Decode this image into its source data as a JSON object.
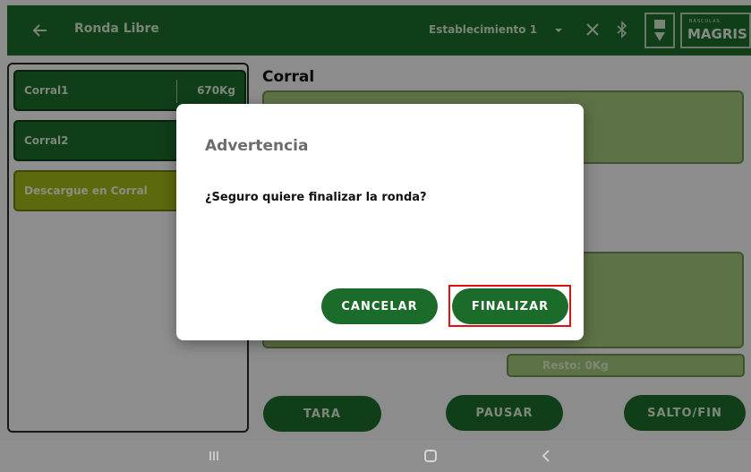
{
  "appbar": {
    "title": "Ronda Libre",
    "establishment": "Establecimiento 1",
    "logo_small": "BÁSCULAS",
    "logo_big": "MAGRIS",
    "bar_color": "#1b6b2b"
  },
  "list": {
    "items": [
      {
        "name": "Corral1",
        "weight": "670Kg"
      },
      {
        "name": "Corral2",
        "weight": ""
      }
    ],
    "action_label": "Descargue en Corral"
  },
  "main": {
    "section_title": "Corral",
    "resto": "Resto: 0Kg",
    "buttons": {
      "tara": "TARA",
      "pausar": "PAUSAR",
      "salto": "SALTO/FIN"
    }
  },
  "dialog": {
    "title": "Advertencia",
    "message": "¿Seguro quiere finalizar la ronda?",
    "cancel": "CANCELAR",
    "confirm": "FINALIZAR"
  },
  "icons": {
    "back": "back-arrow-icon",
    "dropdown": "dropdown-caret-icon",
    "close": "close-icon",
    "bluetooth": "bluetooth-icon"
  },
  "colors": {
    "accent_green": "#1b6b2b",
    "light_green": "#a3c47a",
    "yellow_card": "#a3b418",
    "highlight": "#e01010"
  }
}
